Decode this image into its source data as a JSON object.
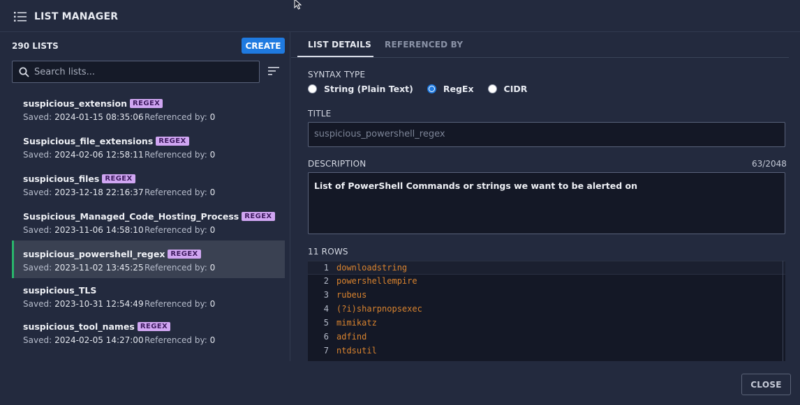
{
  "header": {
    "title": "LIST MANAGER"
  },
  "left": {
    "count": "290 LISTS",
    "create_label": "CREATE",
    "search_placeholder": "Search lists...",
    "items": [
      {
        "name": "suspicious_extension",
        "badge": "REGEX",
        "saved_label": "Saved:",
        "saved": "2024-01-15 08:35:06",
        "ref_label": "Referenced by:",
        "ref": "0",
        "selected": false
      },
      {
        "name": "Suspicious_file_extensions",
        "badge": "REGEX",
        "saved_label": "Saved:",
        "saved": "2024-02-06 12:58:11",
        "ref_label": "Referenced by:",
        "ref": "0",
        "selected": false
      },
      {
        "name": "suspicious_files",
        "badge": "REGEX",
        "saved_label": "Saved:",
        "saved": "2023-12-18 22:16:37",
        "ref_label": "Referenced by:",
        "ref": "0",
        "selected": false
      },
      {
        "name": "Suspicious_Managed_Code_Hosting_Process",
        "badge": "REGEX",
        "saved_label": "Saved:",
        "saved": "2023-11-06 14:58:10",
        "ref_label": "Referenced by:",
        "ref": "0",
        "selected": false
      },
      {
        "name": "suspicious_powershell_regex",
        "badge": "REGEX",
        "saved_label": "Saved:",
        "saved": "2023-11-02 13:45:25",
        "ref_label": "Referenced by:",
        "ref": "0",
        "selected": true
      },
      {
        "name": "suspicious_TLS",
        "badge": "",
        "saved_label": "Saved:",
        "saved": "2023-10-31 12:54:49",
        "ref_label": "Referenced by:",
        "ref": "0",
        "selected": false
      },
      {
        "name": "suspicious_tool_names",
        "badge": "REGEX",
        "saved_label": "Saved:",
        "saved": "2024-02-05 14:27:00",
        "ref_label": "Referenced by:",
        "ref": "0",
        "selected": false
      }
    ]
  },
  "tabs": {
    "details": "LIST DETAILS",
    "referenced": "REFERENCED BY"
  },
  "details": {
    "syntax_label": "SYNTAX TYPE",
    "syntax_options": [
      "String (Plain Text)",
      "RegEx",
      "CIDR"
    ],
    "syntax_selected": "RegEx",
    "title_label": "TITLE",
    "title_value": "suspicious_powershell_regex",
    "description_label": "DESCRIPTION",
    "description_count": "63/2048",
    "description_value": "List of PowerShell Commands or strings we want to be alerted on",
    "rows_label": "11 ROWS",
    "rows": [
      {
        "n": "1",
        "text": "downloadstring"
      },
      {
        "n": "2",
        "text": "powershellempire"
      },
      {
        "n": "3",
        "text": "rubeus"
      },
      {
        "n": "4",
        "text": "(?i)sharpnopsexec"
      },
      {
        "n": "5",
        "text": "mimikatz"
      },
      {
        "n": "6",
        "text": "adfind"
      },
      {
        "n": "7",
        "text": "ntdsutil"
      }
    ]
  },
  "footer": {
    "close_label": "CLOSE"
  },
  "colors": {
    "accent": "#1f7ae0",
    "selected_marker": "#29b56b",
    "badge_bg": "#d0a6f2",
    "code_text": "#d9832e"
  }
}
